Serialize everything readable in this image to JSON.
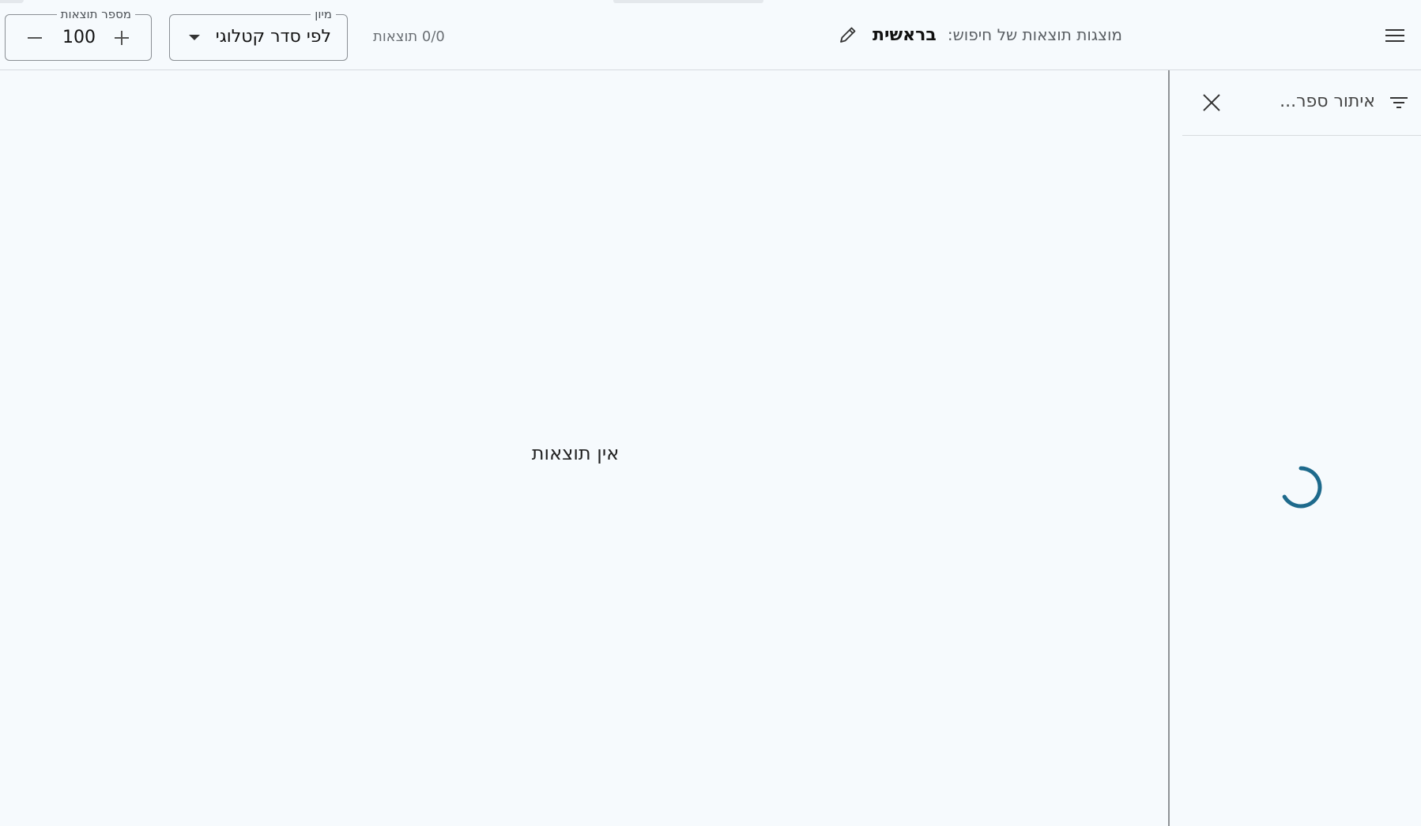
{
  "header": {
    "title_prefix": "מוצגות תוצאות של חיפוש:",
    "search_query": "בראשית",
    "results_count": "0/0 תוצאות",
    "sort": {
      "label": "מיון",
      "value": "לפי סדר קטלוגי"
    },
    "results_per_page": {
      "label": "מספר תוצאות",
      "value": "100"
    }
  },
  "main": {
    "empty_message": "אין תוצאות"
  },
  "side_panel": {
    "search_placeholder": "איתור ספר..."
  },
  "colors": {
    "background": "#f6fafd",
    "accent": "#1e6a8c",
    "border": "#8a8f94"
  },
  "icons": {
    "menu": "hamburger-menu-icon",
    "edit": "pencil-icon",
    "filter": "filter-icon",
    "close": "close-icon",
    "loading": "loading-spinner"
  }
}
